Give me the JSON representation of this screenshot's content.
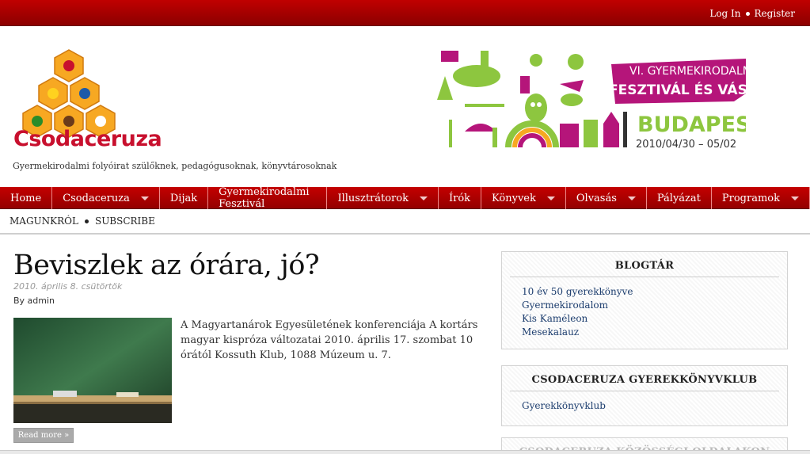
{
  "top": {
    "login": "Log In",
    "register": "Register"
  },
  "site": {
    "name": "Csodaceruza",
    "tagline": "Gyermekirodalmi folyóirat szülőknek, pedagógusoknak, könyvtárosoknak"
  },
  "banner": {
    "line1": "VI. GYERMEKIRODALMI",
    "line2": "FESZTIVÁL ÉS VÁSÁR",
    "city": "BUDAPEST",
    "dates": "2010/04/30 – 05/02"
  },
  "nav": [
    {
      "label": "Home",
      "dropdown": false
    },
    {
      "label": "Csodaceruza",
      "dropdown": true
    },
    {
      "label": "Dijak",
      "dropdown": false
    },
    {
      "label": "Gyermekirodalmi Fesztivál",
      "dropdown": false
    },
    {
      "label": "Illusztrátorok",
      "dropdown": true
    },
    {
      "label": "Írók",
      "dropdown": false
    },
    {
      "label": "Könyvek",
      "dropdown": true
    },
    {
      "label": "Olvasás",
      "dropdown": true
    },
    {
      "label": "Pályázat",
      "dropdown": false
    },
    {
      "label": "Programok",
      "dropdown": true
    }
  ],
  "subnav": {
    "about": "MAGUNKRÓL",
    "subscribe": "SUBSCRIBE"
  },
  "post": {
    "title": "Beviszlek az órára, jó?",
    "date": "2010. április 8. csütörtök",
    "author": "By admin",
    "excerpt": "A Magyartanárok Egyesületének konferenciája A kortárs magyar kispróza változatai 2010. április 17. szombat 10 órától Kossuth Klub, 1088 Múzeum u. 7.",
    "read_more": "Read more »"
  },
  "sidebar": {
    "blogtar": {
      "title": "BLOGTÁR",
      "links": [
        "10 év 50 gyerekkönyve",
        "Gyermekirodalom",
        "Kis Kaméleon",
        "Mesekalauz"
      ]
    },
    "klub": {
      "title": "CSODACERUZA GYEREKKÖNYVKLUB",
      "links": [
        "Gyerekkönyvklub"
      ]
    },
    "third": {
      "title": "CSODACERUZA KÖZÖSSÉGI OLDALAKON"
    }
  },
  "colors": {
    "brand_red": "#c40000",
    "logo_red": "#c8102e",
    "banner_pink": "#b5157a",
    "banner_green": "#8dc63f",
    "link_blue": "#1c3d6e"
  }
}
